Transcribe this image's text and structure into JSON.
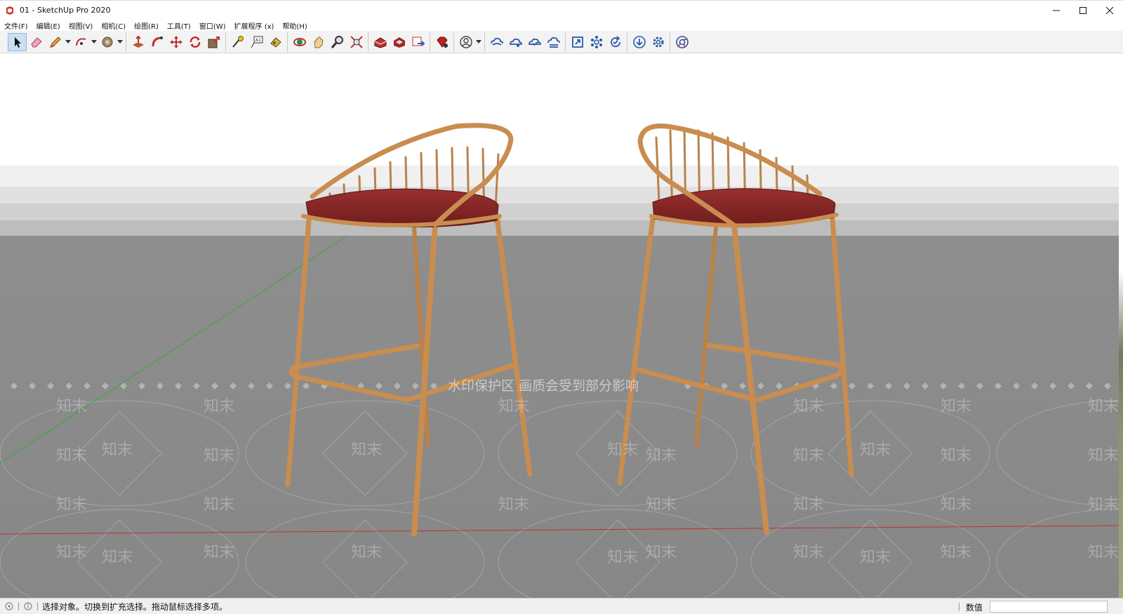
{
  "window": {
    "title": "01 - SketchUp Pro 2020",
    "controls": [
      "minimize-icon",
      "maximize-icon",
      "close-icon"
    ]
  },
  "menu": {
    "items": [
      {
        "label": "文件(F)"
      },
      {
        "label": "编辑(E)"
      },
      {
        "label": "视图(V)"
      },
      {
        "label": "相机(C)"
      },
      {
        "label": "绘图(R)"
      },
      {
        "label": "工具(T)"
      },
      {
        "label": "窗口(W)"
      },
      {
        "label": "扩展程序 (x)"
      },
      {
        "label": "帮助(H)"
      }
    ]
  },
  "toolbar": {
    "groups": [
      [
        "select-icon",
        "eraser-icon",
        "pencil-icon",
        "arc-icon",
        "paint-bucket-icon"
      ],
      [
        "push-pull-icon",
        "follow-me-icon",
        "move-icon",
        "rotate-icon",
        "scale-icon"
      ],
      [
        "tape-measure-icon",
        "text-label-icon",
        "paint-icon"
      ],
      [
        "orbit-icon",
        "pan-icon",
        "zoom-icon",
        "zoom-extents-icon"
      ],
      [
        "warehouse-icon",
        "extension-warehouse-icon",
        "send-to-layout-icon"
      ],
      [
        "ruby-icon"
      ],
      [
        "account-icon"
      ],
      [
        "cloud-sync-icon",
        "cloud-share-icon",
        "cloud-check-icon",
        "cloud-list-icon"
      ],
      [
        "expand-icon",
        "nodes-icon",
        "refresh-icon"
      ],
      [
        "download-icon",
        "settings-gear-icon"
      ],
      [
        "chrome-icon"
      ]
    ],
    "active_tool": "select-icon"
  },
  "viewport": {
    "watermark_text": "水印保护区  画质会受到部分影响",
    "watermark_logo": "知末",
    "colors": {
      "sky": "#ffffff",
      "ground": "#8c8c8c",
      "horizon_band": "#d6d6d6",
      "frame": "#c98d4f",
      "frame_dark": "#9b6633",
      "cushion": "#8f2a2a",
      "cushion_dark": "#6b1a1a",
      "axis_red": "#c23030",
      "axis_green": "#3aa83a"
    }
  },
  "statusbar": {
    "message": "选择对象。切换到扩充选择。拖动鼠标选择多项。",
    "measurements_label": "数值",
    "measurements_value": ""
  }
}
